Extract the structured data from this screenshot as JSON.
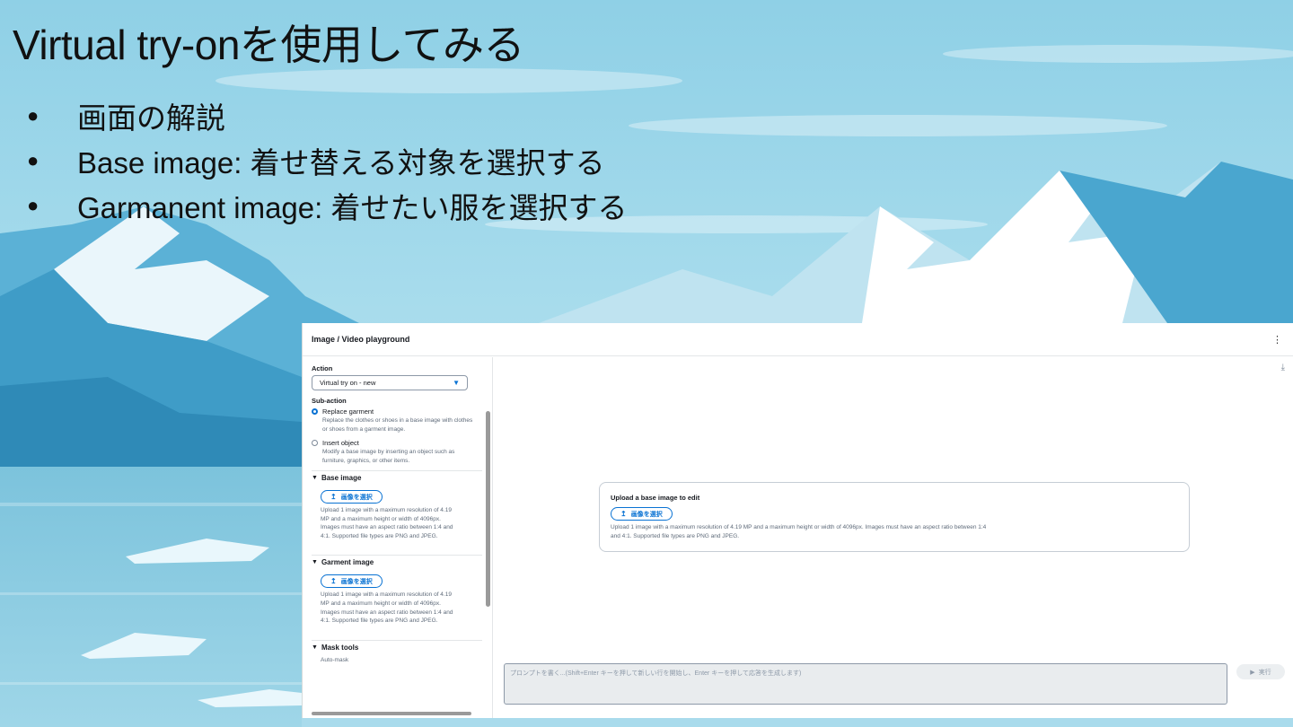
{
  "slide": {
    "title": "Virtual try-onを使用してみる",
    "bullet_glyph": "●",
    "bullets": [
      "画面の解説",
      "Base image: 着せ替える対象を選択する",
      "Garmanent image: 着せたい服を選択する"
    ]
  },
  "app": {
    "header": {
      "title": "Image / Video playground",
      "menu_icon": "kebab-icon"
    },
    "sidebar": {
      "action_label": "Action",
      "action_value": "Virtual try on - new",
      "subaction_label": "Sub-action",
      "options": [
        {
          "label": "Replace garment",
          "desc": "Replace the clothes or shoes in a base image with clothes or shoes from a garment image.",
          "selected": true
        },
        {
          "label": "Insert object",
          "desc": "Modify a base image by inserting an object such as furniture, graphics, or other items.",
          "selected": false
        }
      ],
      "base_image": {
        "heading": "Base image",
        "button": "画像を選択",
        "help": "Upload 1 image with a maximum resolution of 4.19 MP and a maximum height or width of 4096px. Images must have an aspect ratio between 1:4 and 4:1. Supported file types are PNG and JPEG."
      },
      "garment_image": {
        "heading": "Garment image",
        "button": "画像を選択",
        "help": "Upload 1 image with a maximum resolution of 4.19 MP and a maximum height or width of 4096px. Images must have an aspect ratio between 1:4 and 4:1. Supported file types are PNG and JPEG."
      },
      "mask_tools": {
        "heading": "Mask tools",
        "first_item": "Auto-mask"
      }
    },
    "main": {
      "upload_card": {
        "title": "Upload a base image to edit",
        "button": "画像を選択",
        "help": "Upload 1 image with a maximum resolution of 4.19 MP and a maximum height or width of 4096px. Images must have an aspect ratio between 1:4 and 4:1. Supported file types are PNG and JPEG."
      },
      "prompt_placeholder": "プロンプトを書く...(Shift+Enter キーを押して新しい行を開始し、Enter キーを押して応答を生成します)",
      "run_button": "実行"
    }
  },
  "colors": {
    "accent": "#0972d3",
    "sky": "#9fd3e8"
  }
}
